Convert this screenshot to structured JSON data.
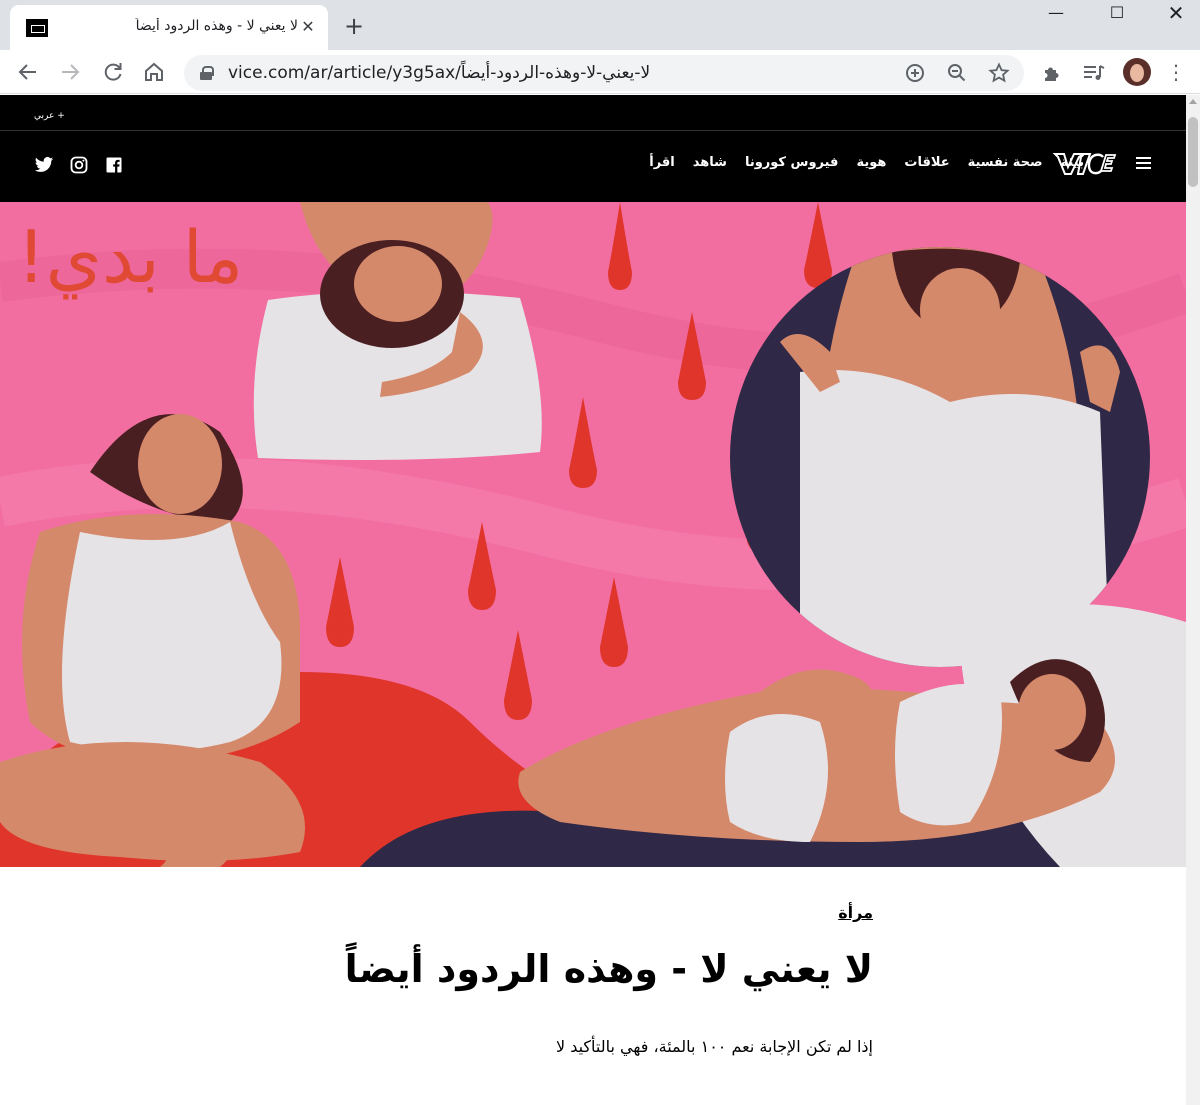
{
  "browser": {
    "tab_title": "لا يعني لا - وهذه الردود أيضاً",
    "tab_close": "✕",
    "new_tab": "+",
    "url": "vice.com/ar/article/y3g5ax/لا-يعني-لا-وهذه-الردود-أيضاً",
    "window_controls": {
      "minimize": "—",
      "maximize": "☐",
      "close": "✕"
    }
  },
  "site": {
    "lang_switch": "+ عربي",
    "nav": [
      "اقرأ",
      "شاهد",
      "فيروس كورونا",
      "هوية",
      "علاقات",
      "صحة نفسية",
      "بيئة"
    ],
    "social_icons": [
      "twitter-icon",
      "instagram-icon",
      "facebook-icon"
    ],
    "logo": "VICE"
  },
  "hero": {
    "painted_text": "ما بدي!",
    "colors": {
      "background": "#f26ea1",
      "blood": "#e0352a",
      "skin": "#d5896b",
      "hair": "#4a1f22",
      "cloth": "#e6e3e6",
      "dark": "#2f2846"
    }
  },
  "article": {
    "category": "مرأة",
    "headline": "لا يعني لا - وهذه الردود أيضاً",
    "dek": "إذا لم تكن الإجابة نعم ١٠٠ بالمئة، فهي بالتأكيد لا"
  }
}
